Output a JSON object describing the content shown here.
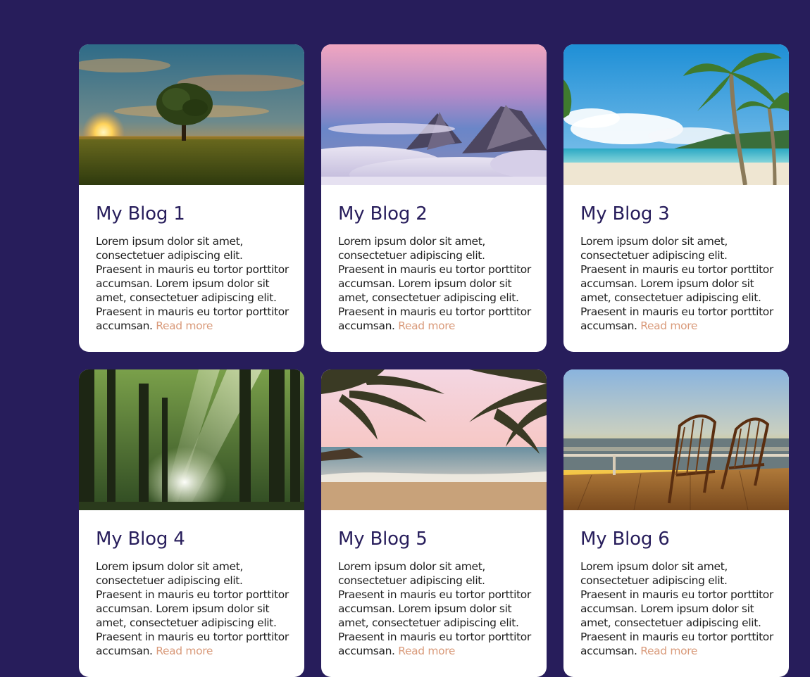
{
  "posts": [
    {
      "title": "My Blog 1",
      "text": "Lorem ipsum dolor sit amet, consectetuer adipiscing elit. Praesent in mauris eu tortor porttitor accumsan. Lorem ipsum dolor sit amet, consectetuer adipiscing elit. Praesent in mauris eu tortor porttitor accumsan.",
      "read_more": "Read more",
      "image": "sunset-tree-field"
    },
    {
      "title": "My Blog 2",
      "text": "Lorem ipsum dolor sit amet, consectetuer adipiscing elit. Praesent in mauris eu tortor porttitor accumsan. Lorem ipsum dolor sit amet, consectetuer adipiscing elit. Praesent in mauris eu tortor porttitor accumsan.",
      "read_more": "Read more",
      "image": "mountain-peaks-clouds"
    },
    {
      "title": "My Blog 3",
      "text": "Lorem ipsum dolor sit amet, consectetuer adipiscing elit. Praesent in mauris eu tortor porttitor accumsan. Lorem ipsum dolor sit amet, consectetuer adipiscing elit. Praesent in mauris eu tortor porttitor accumsan.",
      "read_more": "Read more",
      "image": "tropical-beach-palms"
    },
    {
      "title": "My Blog 4",
      "text": "Lorem ipsum dolor sit amet, consectetuer adipiscing elit. Praesent in mauris eu tortor porttitor accumsan. Lorem ipsum dolor sit amet, consectetuer adipiscing elit. Praesent in mauris eu tortor porttitor accumsan.",
      "read_more": "Read more",
      "image": "forest-sunbeams"
    },
    {
      "title": "My Blog 5",
      "text": "Lorem ipsum dolor sit amet, consectetuer adipiscing elit. Praesent in mauris eu tortor porttitor accumsan. Lorem ipsum dolor sit amet, consectetuer adipiscing elit. Praesent in mauris eu tortor porttitor accumsan.",
      "read_more": "Read more",
      "image": "beach-sunset-palm-fronds"
    },
    {
      "title": "My Blog 6",
      "text": "Lorem ipsum dolor sit amet, consectetuer adipiscing elit. Praesent in mauris eu tortor porttitor accumsan. Lorem ipsum dolor sit amet, consectetuer adipiscing elit. Praesent in mauris eu tortor porttitor accumsan.",
      "read_more": "Read more",
      "image": "deck-chairs-sea-sunset"
    }
  ],
  "colors": {
    "page_background": "#271d5b",
    "card_background": "#ffffff",
    "title": "#271d5b",
    "body_text": "#1e1e1e",
    "read_more_link": "#d99a7a"
  }
}
